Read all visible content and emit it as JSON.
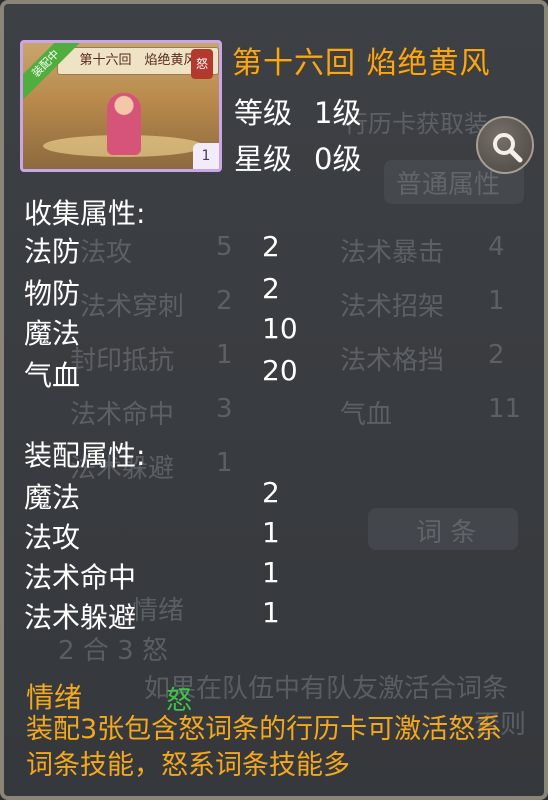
{
  "card": {
    "banner": "第十六回　焰绝黄风",
    "ribbon": "装配中",
    "seal": "怒",
    "number": "1"
  },
  "header": {
    "title": "第十六回 焰绝黄风",
    "level_label": "等级",
    "level_value": "1级",
    "star_label": "星级",
    "star_value": "0级"
  },
  "collect": {
    "heading": "收集属性:",
    "rows": [
      {
        "label": "法防",
        "value": "2"
      },
      {
        "label": "物防",
        "value": "2"
      },
      {
        "label": "魔法",
        "value": "10"
      },
      {
        "label": "气血",
        "value": "20"
      }
    ]
  },
  "equip": {
    "heading": "装配属性:",
    "rows": [
      {
        "label": "魔法",
        "value": "2"
      },
      {
        "label": "法攻",
        "value": "1"
      },
      {
        "label": "法术命中",
        "value": "1"
      },
      {
        "label": "法术躲避",
        "value": "1"
      }
    ]
  },
  "mood": {
    "label": "情绪",
    "value": "怒",
    "description": "装配3张包含怒词条的行历卡可激活怒系词条技能，怒系词条技能多"
  },
  "background": {
    "top_text": "行历卡获取装",
    "tab": "普通属性",
    "left_col": [
      {
        "label": "法攻",
        "value": "5"
      },
      {
        "label": "法术穿刺",
        "value": "2"
      },
      {
        "label": "封印抵抗",
        "value": "1"
      },
      {
        "label": "法术命中",
        "value": "3"
      },
      {
        "label": "法术躲避",
        "value": "1"
      }
    ],
    "right_col": [
      {
        "label": "法术暴击",
        "value": "4"
      },
      {
        "label": "法术招架",
        "value": "1"
      },
      {
        "label": "法术格挡",
        "value": "2"
      },
      {
        "label": "气血",
        "value": "11"
      }
    ],
    "button": "词 条",
    "emotion": "情绪",
    "counts": "2 合 3 怒",
    "desc": "如果在队伍中有队友激活合词条",
    "desc2": "否则"
  },
  "colors": {
    "accent_orange": "#f3a81e",
    "mood_green": "#3ec44a",
    "card_border": "#c9a7e7"
  }
}
